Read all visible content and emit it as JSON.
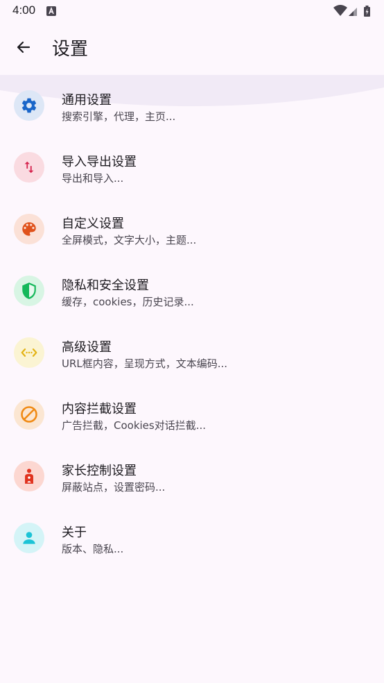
{
  "status_bar": {
    "time": "4:00"
  },
  "header": {
    "title": "设置"
  },
  "items": [
    {
      "title": "通用设置",
      "subtitle": "搜索引擎，代理，主页...",
      "icon": "gear-icon",
      "bg": "#dde7f6",
      "fg": "#1a66c9"
    },
    {
      "title": "导入导出设置",
      "subtitle": "导出和导入...",
      "icon": "import-export-icon",
      "bg": "#fadbe1",
      "fg": "#d6254f"
    },
    {
      "title": "自定义设置",
      "subtitle": "全屏模式，文字大小，主题...",
      "icon": "palette-icon",
      "bg": "#fbe1d7",
      "fg": "#e0521b"
    },
    {
      "title": "隐私和安全设置",
      "subtitle": "缓存，cookies，历史记录...",
      "icon": "shield-icon",
      "bg": "#d8f5e4",
      "fg": "#14b85a"
    },
    {
      "title": "高级设置",
      "subtitle": "URL框内容，呈现方式，文本编码...",
      "icon": "code-icon",
      "bg": "#fbf4d3",
      "fg": "#e3b213"
    },
    {
      "title": "内容拦截设置",
      "subtitle": "广告拦截，Cookies对话拦截...",
      "icon": "block-icon",
      "bg": "#fbe6d2",
      "fg": "#f08a14"
    },
    {
      "title": "家长控制设置",
      "subtitle": "屏蔽站点，设置密码...",
      "icon": "parent-icon",
      "bg": "#fcd7d1",
      "fg": "#e0321e"
    },
    {
      "title": "关于",
      "subtitle": "版本、隐私...",
      "icon": "person-icon",
      "bg": "#d4f4f7",
      "fg": "#1cc3d6"
    }
  ]
}
